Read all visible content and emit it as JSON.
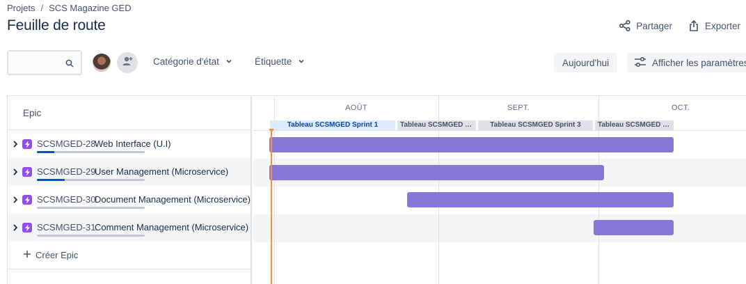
{
  "breadcrumb": {
    "projects": "Projets",
    "separator": "/",
    "project": "SCS Magazine GED"
  },
  "page": {
    "title": "Feuille de route"
  },
  "actions": {
    "share": "Partager",
    "export": "Exporter"
  },
  "toolbar": {
    "search_placeholder": "",
    "filter_status": "Catégorie d'état",
    "filter_label": "Étiquette",
    "today": "Aujourd'hui",
    "settings": "Afficher les paramètres"
  },
  "roadmap": {
    "column_header": "Epic",
    "months": [
      "AOÛT",
      "SEPT.",
      "OCT."
    ],
    "sprints": [
      {
        "label": "Tableau SCSMGED Sprint 1",
        "active": true
      },
      {
        "label": "Tableau SCSMGED S...",
        "active": false
      },
      {
        "label": "Tableau SCSMGED Sprint 3",
        "active": false
      },
      {
        "label": "Tableau SCSMGED S...",
        "active": false
      }
    ],
    "epics": [
      {
        "key": "SCSMGED-28",
        "name": "Web Interface (U.I)",
        "progress": 0.16
      },
      {
        "key": "SCSMGED-29",
        "name": "User Management (Microservice)",
        "progress": 0.26
      },
      {
        "key": "SCSMGED-30",
        "name": "Document Management (Microservice)",
        "progress": 0.0
      },
      {
        "key": "SCSMGED-31",
        "name": "Comment Management (Microservice)",
        "progress": 0.0
      }
    ],
    "create_epic": "Créer Epic"
  },
  "colors": {
    "epic_bar": "#8777d9",
    "epic_icon": "#904ee2",
    "progress": "#0052cc",
    "today": "#f79233",
    "active_sprint": "#deebff"
  }
}
